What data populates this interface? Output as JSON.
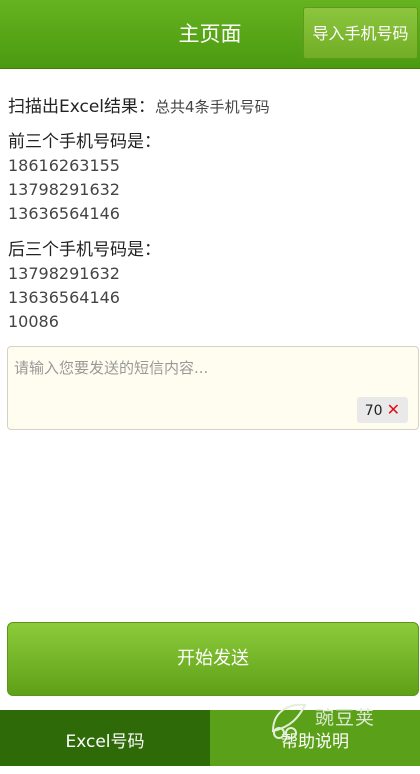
{
  "header": {
    "title": "主页面",
    "import_label": "导入手机号码"
  },
  "scan": {
    "label": "扫描出Excel结果：",
    "result": "总共4条手机号码"
  },
  "first_three": {
    "title": "前三个手机号码是：",
    "numbers": [
      "18616263155",
      "13798291632",
      "13636564146"
    ]
  },
  "last_three": {
    "title": "后三个手机号码是：",
    "numbers": [
      "13798291632",
      "13636564146",
      "10086"
    ]
  },
  "message": {
    "placeholder": "请输入您要发送的短信内容...",
    "char_count": "70",
    "clear_icon": "close-icon"
  },
  "send_label": "开始发送",
  "tabs": [
    {
      "label": "Excel号码"
    },
    {
      "label": "帮助说明"
    }
  ],
  "watermark": "豌豆荚",
  "colors": {
    "header": "#4b9a10",
    "button": "#76b52a",
    "tab_active": "#2f6a08",
    "clear_icon": "#e0101a"
  }
}
